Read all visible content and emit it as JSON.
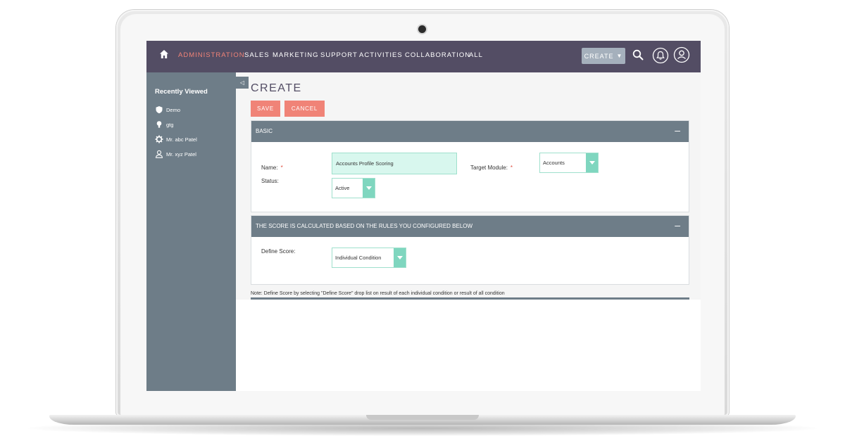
{
  "nav": {
    "items": [
      {
        "label": "ADMINISTRATION",
        "active": true
      },
      {
        "label": "SALES",
        "active": false
      },
      {
        "label": "MARKETING",
        "active": false
      },
      {
        "label": "SUPPORT",
        "active": false
      },
      {
        "label": "ACTIVITIES",
        "active": false
      },
      {
        "label": "COLLABORATION",
        "active": false
      },
      {
        "label": "ALL",
        "active": false
      }
    ],
    "create_label": "CREATE",
    "icons": [
      "home-icon",
      "search-icon",
      "bell-icon",
      "user-icon"
    ]
  },
  "sidebar": {
    "title": "Recently Viewed",
    "items": [
      {
        "label": "Demo",
        "icon": "shield-icon"
      },
      {
        "label": "gtg",
        "icon": "lightbulb-icon"
      },
      {
        "label": "Mr. abc Patel",
        "icon": "gear-icon"
      },
      {
        "label": "Mr. xyz Patel",
        "icon": "person-icon"
      }
    ],
    "collapse_glyph": "◁"
  },
  "page": {
    "title": "CREATE",
    "save_label": "SAVE",
    "cancel_label": "CANCEL"
  },
  "basic_panel": {
    "header": "BASIC",
    "collapse": "–",
    "name_label": "Name:",
    "name_value": "Accounts Profile Scoring",
    "target_module_label": "Target Module:",
    "target_module_value": "Accounts",
    "status_label": "Status:",
    "status_value": "Active",
    "required_mark": "*"
  },
  "score_panel": {
    "header": "THE SCORE IS CALCULATED BASED ON THE RULES YOU CONFIGURED BELOW",
    "collapse": "–",
    "define_score_label": "Define Score:",
    "define_score_value": "Individual Condition"
  },
  "note": "Note: Define Score by selecting \"Define Score\" drop list on result of each individual condition or result of all condition",
  "colors": {
    "topbar": "#534d64",
    "sidebar": "#6e7d88",
    "accent": "#f08377",
    "field_bg": "#d8f7ee",
    "select_arrow": "#7fd6bf",
    "create_button": "#a5b0bc"
  }
}
